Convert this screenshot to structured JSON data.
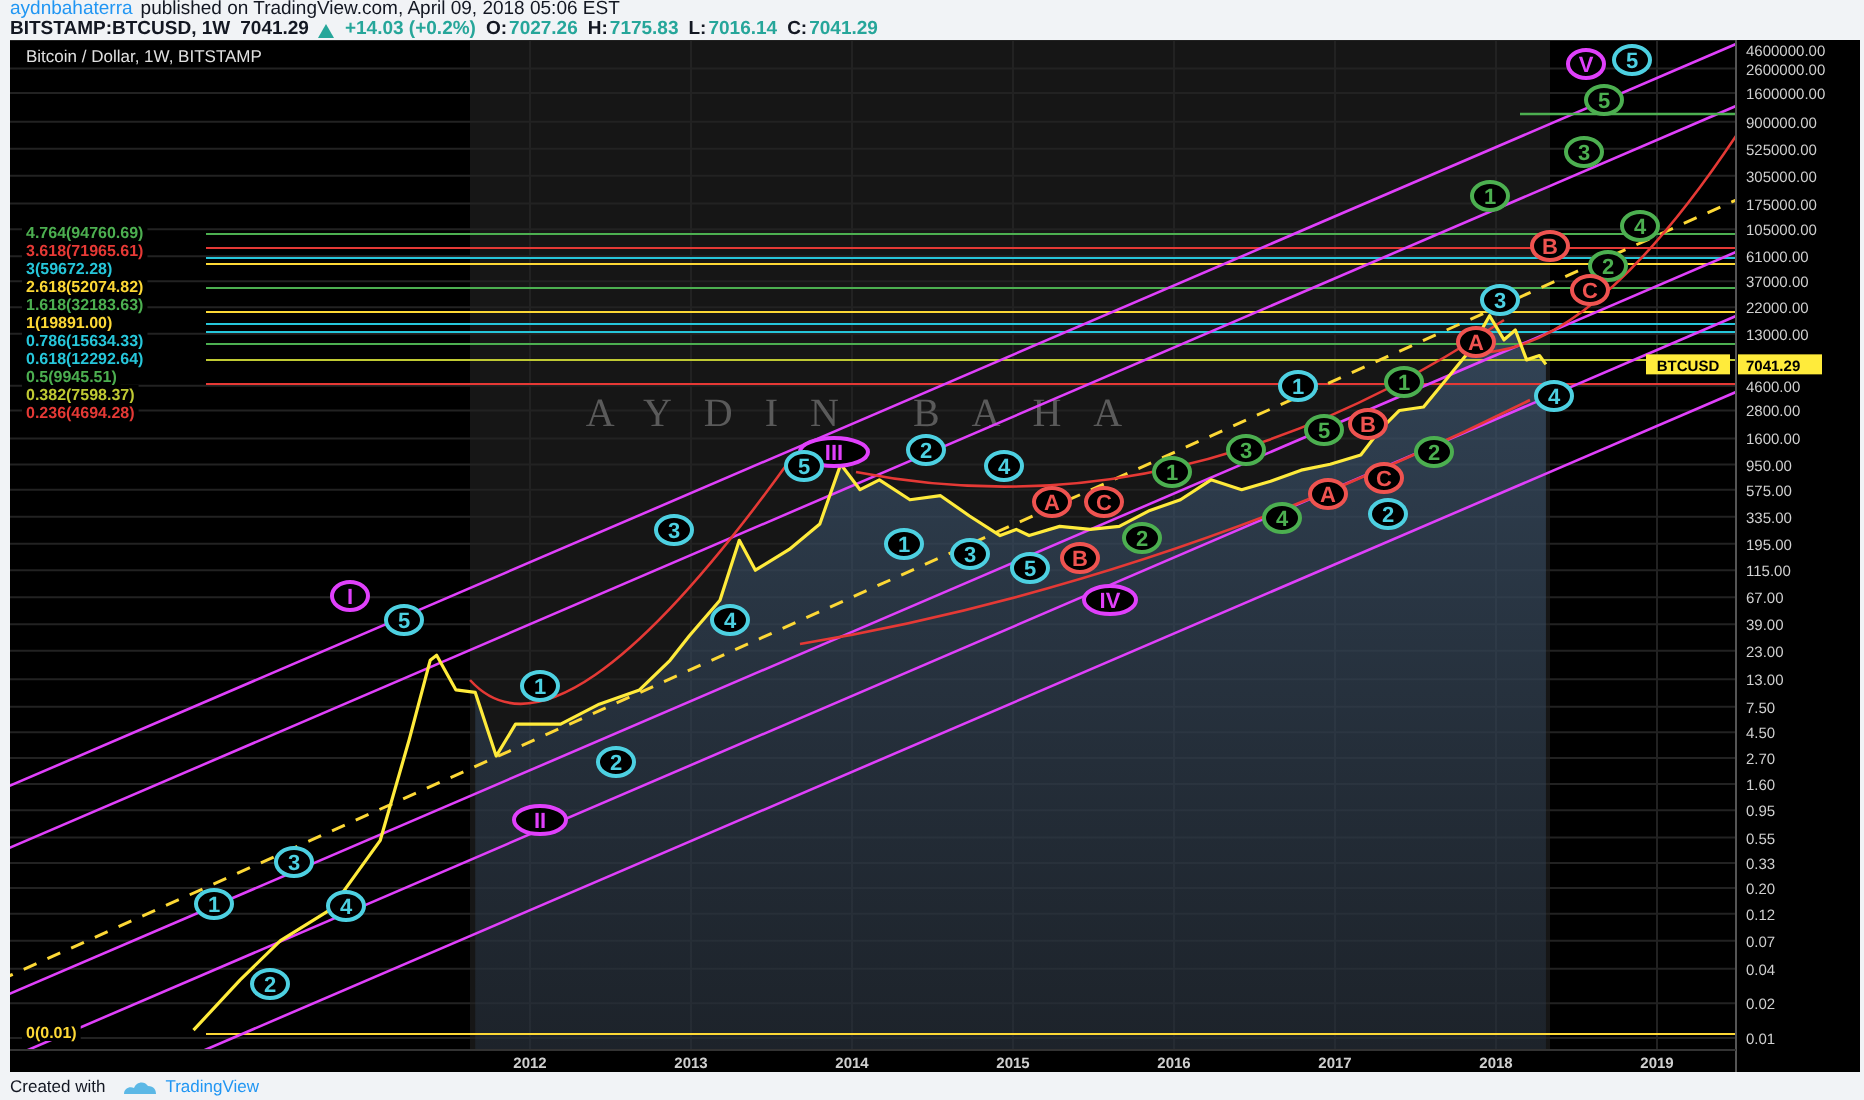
{
  "header": {
    "author": "aydnbahaterra",
    "published": "published on TradingView.com, April 09, 2018 05:06 EST"
  },
  "quote": {
    "symbol": "BITSTAMP:BTCUSD, 1W",
    "last": "7041.29",
    "up": true,
    "change": "+14.03 (+0.2%)",
    "ohlc": [
      {
        "key": "O:",
        "value": "7027.26"
      },
      {
        "key": "H:",
        "value": "7175.83"
      },
      {
        "key": "L:",
        "value": "7016.14"
      },
      {
        "key": "C:",
        "value": "7041.29"
      }
    ]
  },
  "chart": {
    "title": "Bitcoin / Dollar, 1W, BITSTAMP",
    "overlay_text": "AYDIN BAHA",
    "symbol_tag": "BTCUSD",
    "price_tag": "7041.29",
    "fib_levels": [
      {
        "text": "4.764(94760.69)",
        "color": "#4caf50"
      },
      {
        "text": "3.618(71965.61)",
        "color": "#e53935"
      },
      {
        "text": "3(59672.28)",
        "color": "#26c6da"
      },
      {
        "text": "2.618(52074.82)",
        "color": "#fdd835"
      },
      {
        "text": "1.618(32183.63)",
        "color": "#4caf50"
      },
      {
        "text": "1(19891.00)",
        "color": "#fdd835"
      },
      {
        "text": "0.786(15634.33)",
        "color": "#26c6da"
      },
      {
        "text": "0.618(12292.64)",
        "color": "#26c6da"
      },
      {
        "text": "0.5(9945.51)",
        "color": "#4caf50"
      },
      {
        "text": "0.382(7598.37)",
        "color": "#c0ca33"
      },
      {
        "text": "0.236(4694.28)",
        "color": "#e53935"
      },
      {
        "text": "0(0.01)",
        "color": "#fdd835"
      }
    ],
    "wave_labels": [
      {
        "text": "I",
        "color": "#e040fb"
      },
      {
        "text": "II",
        "color": "#e040fb"
      },
      {
        "text": "III",
        "color": "#e040fb"
      },
      {
        "text": "IV",
        "color": "#e040fb"
      },
      {
        "text": "V",
        "color": "#e040fb"
      },
      {
        "text": "1",
        "color": "#4dd0e1"
      },
      {
        "text": "2",
        "color": "#4dd0e1"
      },
      {
        "text": "3",
        "color": "#4dd0e1"
      },
      {
        "text": "4",
        "color": "#4dd0e1"
      },
      {
        "text": "5",
        "color": "#4dd0e1"
      },
      {
        "text": "1",
        "color": "#4dd0e1"
      },
      {
        "text": "2",
        "color": "#4dd0e1"
      },
      {
        "text": "3",
        "color": "#4dd0e1"
      },
      {
        "text": "4",
        "color": "#4dd0e1"
      },
      {
        "text": "5",
        "color": "#4dd0e1"
      },
      {
        "text": "1",
        "color": "#4dd0e1"
      },
      {
        "text": "2",
        "color": "#4dd0e1"
      },
      {
        "text": "3",
        "color": "#4dd0e1"
      },
      {
        "text": "4",
        "color": "#4dd0e1"
      },
      {
        "text": "5",
        "color": "#4dd0e1"
      },
      {
        "text": "1",
        "color": "#4dd0e1"
      },
      {
        "text": "2",
        "color": "#4dd0e1"
      },
      {
        "text": "3",
        "color": "#4dd0e1"
      },
      {
        "text": "4",
        "color": "#4dd0e1"
      },
      {
        "text": "5",
        "color": "#4dd0e1"
      },
      {
        "text": "2",
        "color": "#4caf50"
      },
      {
        "text": "1",
        "color": "#4caf50"
      },
      {
        "text": "3",
        "color": "#4caf50"
      },
      {
        "text": "4",
        "color": "#4caf50"
      },
      {
        "text": "5",
        "color": "#4caf50"
      },
      {
        "text": "1",
        "color": "#4caf50"
      },
      {
        "text": "2",
        "color": "#4caf50"
      },
      {
        "text": "1",
        "color": "#4caf50"
      },
      {
        "text": "3",
        "color": "#4caf50"
      },
      {
        "text": "2",
        "color": "#4caf50"
      },
      {
        "text": "4",
        "color": "#4caf50"
      },
      {
        "text": "5",
        "color": "#4caf50"
      },
      {
        "text": "A",
        "color": "#ef5350"
      },
      {
        "text": "B",
        "color": "#ef5350"
      },
      {
        "text": "C",
        "color": "#ef5350"
      },
      {
        "text": "A",
        "color": "#ef5350"
      },
      {
        "text": "B",
        "color": "#ef5350"
      },
      {
        "text": "C",
        "color": "#ef5350"
      },
      {
        "text": "A",
        "color": "#ef5350"
      },
      {
        "text": "B",
        "color": "#ef5350"
      },
      {
        "text": "C",
        "color": "#ef5350"
      }
    ],
    "x_axis_labels": [
      "2012",
      "2013",
      "2014",
      "2015",
      "2016",
      "2017",
      "2018",
      "2019"
    ],
    "y_axis_labels": [
      "4600000.00",
      "2600000.00",
      "1600000.00",
      "900000.00",
      "525000.00",
      "305000.00",
      "175000.00",
      "105000.00",
      "61000.00",
      "37000.00",
      "22000.00",
      "13000.00",
      "4600.00",
      "2800.00",
      "1600.00",
      "950.00",
      "575.00",
      "335.00",
      "195.00",
      "115.00",
      "67.00",
      "39.00",
      "23.00",
      "13.00",
      "7.50",
      "4.50",
      "2.70",
      "1.60",
      "0.95",
      "0.55",
      "0.33",
      "0.20",
      "0.12",
      "0.07",
      "0.04",
      "0.02",
      "0.01"
    ]
  },
  "footer": {
    "created_with": "Created with",
    "brand": "TradingView"
  }
}
